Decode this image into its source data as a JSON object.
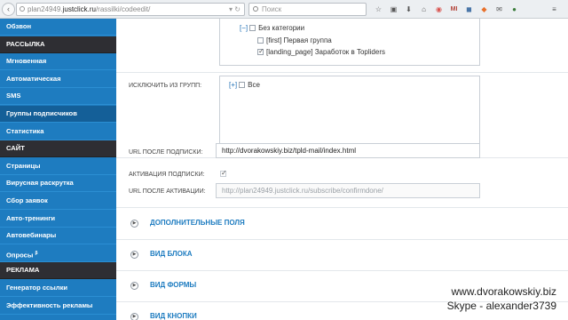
{
  "browser": {
    "url_prefix": "plan24949.",
    "url_host": "justclick.ru",
    "url_path": "/rassilki/codeedit/",
    "search_placeholder": "Поиск",
    "mi_label": "MI"
  },
  "sidebar": {
    "items": [
      {
        "label": "Обзвон",
        "type": "item"
      },
      {
        "label": "РАССЫЛКА",
        "type": "section"
      },
      {
        "label": "Мгновенная",
        "type": "item"
      },
      {
        "label": "Автоматическая",
        "type": "item"
      },
      {
        "label": "SMS",
        "type": "item"
      },
      {
        "label": "Группы подписчиков",
        "type": "active"
      },
      {
        "label": "Статистика",
        "type": "item"
      },
      {
        "label": "САЙТ",
        "type": "section"
      },
      {
        "label": "Страницы",
        "type": "item"
      },
      {
        "label": "Вирусная раскрутка",
        "type": "item"
      },
      {
        "label": "Сбор заявок",
        "type": "item"
      },
      {
        "label": "Авто-тренинги",
        "type": "item"
      },
      {
        "label": "Автовебинары",
        "type": "item"
      },
      {
        "label": "Опросы",
        "sup": "β",
        "type": "item"
      },
      {
        "label": "РЕКЛАМА",
        "type": "section"
      },
      {
        "label": "Генератор ссылки",
        "type": "item"
      },
      {
        "label": "Эффективность рекламы",
        "type": "item"
      }
    ]
  },
  "groups_tree": {
    "toggle": "[−]",
    "root_label": "Без категории",
    "children": [
      {
        "label": "[first] Первая группа",
        "checked": false
      },
      {
        "label": "[landing_page] Заработок в Topliders",
        "checked": true
      }
    ]
  },
  "exclude": {
    "label": "ИСКЛЮЧИТЬ ИЗ ГРУПП:",
    "toggle": "[+]",
    "all_label": "Все"
  },
  "fields": {
    "subscribe_url_label": "URL ПОСЛЕ ПОДПИСКИ:",
    "subscribe_url_value": "http://dvorakowskiy.biz/tpld-mail/index.html",
    "activation_label": "АКТИВАЦИЯ ПОДПИСКИ:",
    "activation_checked": true,
    "activation_url_label": "URL ПОСЛЕ АКТИВАЦИИ:",
    "activation_url_placeholder": "http://plan24949.justclick.ru/subscribe/confirmdone/"
  },
  "accordion": [
    {
      "label": "ДОПОЛНИТЕЛЬНЫЕ ПОЛЯ"
    },
    {
      "label": "ВИД БЛОКА"
    },
    {
      "label": "ВИД ФОРМЫ"
    },
    {
      "label": "ВИД КНОПКИ"
    }
  ],
  "watermark": {
    "line1": "www.dvorakowskiy.biz",
    "line2": "Skype - alexander3739"
  }
}
